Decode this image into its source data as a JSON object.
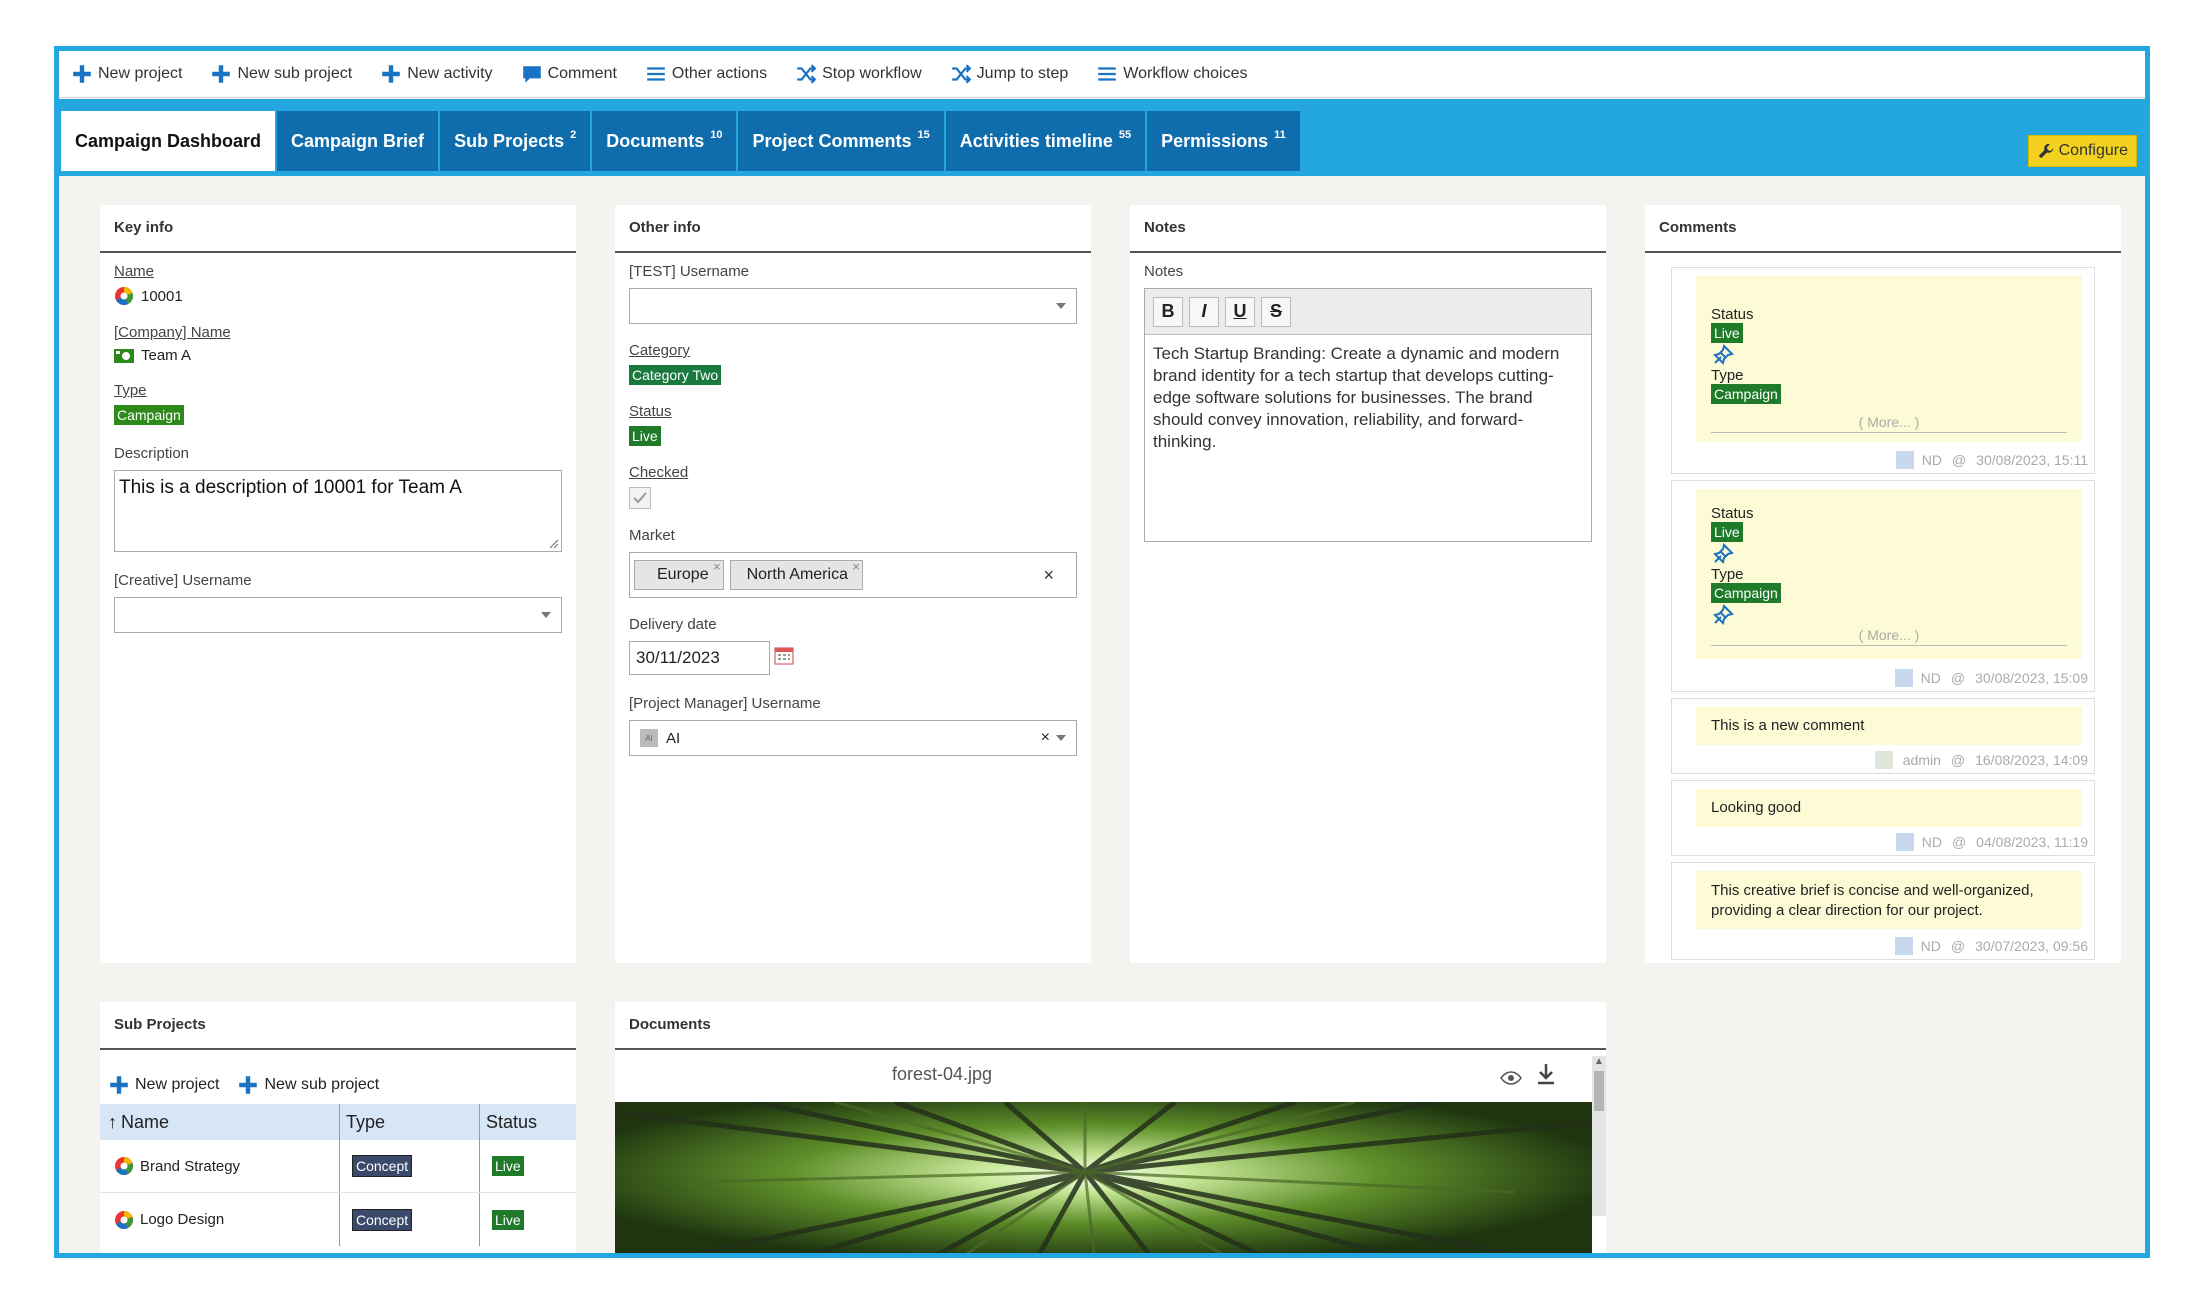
{
  "toolbar": {
    "buttons": [
      {
        "label": "New project",
        "icon": "plus-icon"
      },
      {
        "label": "New sub project",
        "icon": "plus-icon"
      },
      {
        "label": "New activity",
        "icon": "plus-icon"
      },
      {
        "label": "Comment",
        "icon": "comment-icon"
      },
      {
        "label": "Other actions",
        "icon": "menu-icon"
      },
      {
        "label": "Stop workflow",
        "icon": "shuffle-icon"
      },
      {
        "label": "Jump to step",
        "icon": "shuffle-icon"
      },
      {
        "label": "Workflow choices",
        "icon": "menu-icon"
      }
    ]
  },
  "tabs": [
    {
      "label": "Campaign Dashboard",
      "count": ""
    },
    {
      "label": "Campaign Brief",
      "count": ""
    },
    {
      "label": "Sub Projects",
      "count": "2"
    },
    {
      "label": "Documents",
      "count": "10"
    },
    {
      "label": "Project Comments",
      "count": "15"
    },
    {
      "label": "Activities timeline",
      "count": "55"
    },
    {
      "label": "Permissions",
      "count": "11"
    }
  ],
  "configure_label": "Configure",
  "key_info": {
    "title": "Key info",
    "name_label": "Name",
    "name_value": "10001",
    "company_label": "[Company] Name",
    "company_value": "Team A",
    "type_label": "Type",
    "type_value": "Campaign",
    "description_label": "Description",
    "description_value": "This is a description of 10001 for Team A",
    "creative_label": "[Creative] Username",
    "creative_value": ""
  },
  "other_info": {
    "title": "Other info",
    "test_username_label": "[TEST] Username",
    "test_username_value": "",
    "category_label": "Category",
    "category_value": "Category Two",
    "status_label": "Status",
    "status_value": "Live",
    "checked_label": "Checked",
    "checked_value": true,
    "market_label": "Market",
    "market_values": [
      "Europe",
      "North America"
    ],
    "delivery_label": "Delivery date",
    "delivery_value": "30/11/2023",
    "pm_label": "[Project Manager] Username",
    "pm_value": "AI",
    "pm_avatar": "AI"
  },
  "notes": {
    "title": "Notes",
    "label": "Notes",
    "toolbar": [
      "B",
      "I",
      "U",
      "S"
    ],
    "text": "Tech Startup Branding: Create a dynamic and modern brand identity for a tech startup that develops cutting-edge software solutions for businesses. The brand should convey innovation, reliability, and forward-thinking."
  },
  "comments": {
    "title": "Comments",
    "items": [
      {
        "status_label": "Status",
        "status": "Live",
        "type_label": "Type",
        "type": "Campaign",
        "more": "( More... )",
        "author": "ND",
        "at": "@",
        "date": "30/08/2023, 15:11"
      },
      {
        "status_label": "Status",
        "status": "Live",
        "type_label": "Type",
        "type": "Campaign",
        "more": "( More... )",
        "author": "ND",
        "at": "@",
        "date": "30/08/2023, 15:09"
      },
      {
        "text": "This is a new comment",
        "author": "admin",
        "at": "@",
        "date": "16/08/2023, 14:09"
      },
      {
        "text": "Looking good",
        "author": "ND",
        "at": "@",
        "date": "04/08/2023, 11:19"
      },
      {
        "text": "This creative brief is concise and well-organized, providing a clear direction for our project.",
        "author": "ND",
        "at": "@",
        "date": "30/07/2023, 09:56"
      }
    ]
  },
  "sub_projects": {
    "title": "Sub Projects",
    "new_project": "New project",
    "new_sub_project": "New sub project",
    "columns": [
      "Name",
      "Type",
      "Status"
    ],
    "rows": [
      {
        "name": "Brand Strategy",
        "type": "Concept",
        "status": "Live"
      },
      {
        "name": "Logo Design",
        "type": "Concept",
        "status": "Live"
      }
    ]
  },
  "documents": {
    "title": "Documents",
    "filename": "forest-04.jpg"
  },
  "colors": {
    "frame": "#24a6e0",
    "tab": "#0f6cad",
    "accent_blue": "#1a73c2",
    "live_green": "#2d8a1a",
    "comment_bg": "#fdfbd6",
    "configure": "#f2d21e"
  }
}
